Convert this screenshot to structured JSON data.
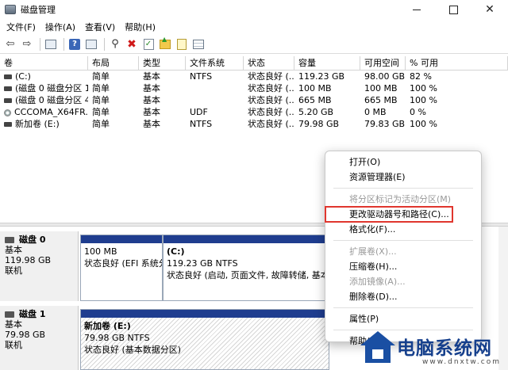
{
  "window": {
    "title": "磁盘管理"
  },
  "menubar": [
    "文件(F)",
    "操作(A)",
    "查看(V)",
    "帮助(H)"
  ],
  "table": {
    "columns": [
      "卷",
      "布局",
      "类型",
      "文件系统",
      "状态",
      "容量",
      "可用空间",
      "% 可用"
    ],
    "rows": [
      [
        "(C:)",
        "简单",
        "基本",
        "NTFS",
        "状态良好 (...",
        "119.23 GB",
        "98.00 GB",
        "82 %"
      ],
      [
        "(磁盘 0 磁盘分区 1)",
        "简单",
        "基本",
        "",
        "状态良好 (...",
        "100 MB",
        "100 MB",
        "100 %"
      ],
      [
        "(磁盘 0 磁盘分区 4)",
        "简单",
        "基本",
        "",
        "状态良好 (...",
        "665 MB",
        "665 MB",
        "100 %"
      ],
      [
        "CCCOMA_X64FR...",
        "简单",
        "基本",
        "UDF",
        "状态良好 (...",
        "5.20 GB",
        "0 MB",
        "0 %"
      ],
      [
        "新加卷 (E:)",
        "简单",
        "基本",
        "NTFS",
        "状态良好 (...",
        "79.98 GB",
        "79.83 GB",
        "100 %"
      ]
    ]
  },
  "disks": [
    {
      "name": "磁盘 0",
      "type": "基本",
      "size": "119.98 GB",
      "status": "联机"
    },
    {
      "name": "磁盘 1",
      "type": "基本",
      "size": "79.98 GB",
      "status": "联机"
    }
  ],
  "partitions": {
    "d0p1": {
      "size": "100 MB",
      "status": "状态良好 (EFI 系统分"
    },
    "d0p2": {
      "name": "(C:)",
      "size": "119.23 GB NTFS",
      "status": "状态良好 (启动, 页面文件, 故障转储, 基本数"
    },
    "d1p1": {
      "name": "新加卷  (E:)",
      "size": "79.98 GB NTFS",
      "status": "状态良好 (基本数据分区)"
    }
  },
  "context_menu": {
    "open": "打开(O)",
    "explorer": "资源管理器(E)",
    "mark_active": "将分区标记为活动分区(M)",
    "change_letter": "更改驱动器号和路径(C)...",
    "format": "格式化(F)...",
    "extend": "扩展卷(X)...",
    "shrink": "压缩卷(H)...",
    "add_mirror": "添加镜像(A)...",
    "delete": "删除卷(D)...",
    "properties": "属性(P)",
    "help": "帮助(H)"
  },
  "watermark": {
    "title": "电脑系统网",
    "url": "www.dnxtw.com"
  },
  "colors": {
    "partition_bar": "#1f3d8f",
    "highlight_outline": "#e0362e",
    "watermark_blue": "#1a4fa3"
  }
}
